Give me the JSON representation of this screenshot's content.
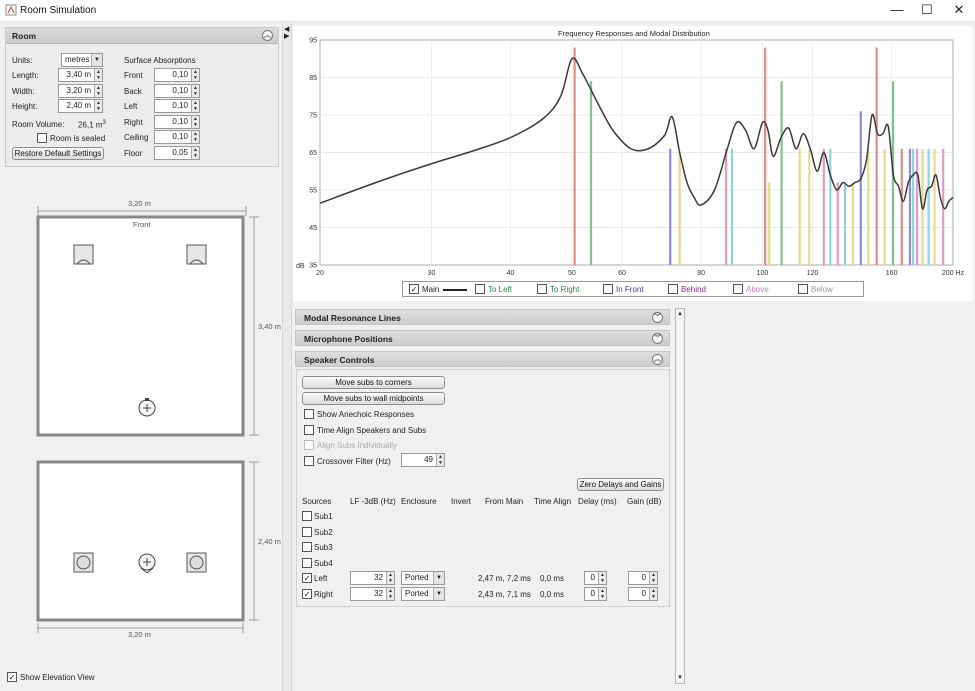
{
  "window": {
    "title": "Room Simulation",
    "minimize": "—",
    "maximize": "☐",
    "close": "✕"
  },
  "room_panel": {
    "title": "Room",
    "units_label": "Units:",
    "units_value": "metres",
    "length_label": "Length:",
    "length_value": "3,40 m",
    "width_label": "Width:",
    "width_value": "3,20 m",
    "height_label": "Height:",
    "height_value": "2,40 m",
    "volume_label": "Room Volume:",
    "volume_value": "26,1 m",
    "volume_unit_sup": "3",
    "sealed_label": "Room is sealed",
    "sealed_checked": false,
    "restore_button": "Restore Default Settings",
    "absorptions_title": "Surface Absorptions",
    "absorptions": [
      {
        "label": "Front",
        "value": "0,10"
      },
      {
        "label": "Back",
        "value": "0,10"
      },
      {
        "label": "Left",
        "value": "0,10"
      },
      {
        "label": "Right",
        "value": "0,10"
      },
      {
        "label": "Ceiling",
        "value": "0,10"
      },
      {
        "label": "Floor",
        "value": "0,05"
      }
    ]
  },
  "plan_view": {
    "top_dim": "3,20 m",
    "side_dim": "3,40 m",
    "front_label": "Front"
  },
  "elevation_view": {
    "side_dim": "2,40 m",
    "bottom_dim": "3,20 m"
  },
  "show_elevation": {
    "label": "Show Elevation View",
    "checked": true
  },
  "chart_data": {
    "type": "line",
    "title": "Frequency Responses and Modal Distribution",
    "ylabel": "dB",
    "xscale": "log",
    "xlim": [
      20,
      200
    ],
    "ylim": [
      35,
      95
    ],
    "x_ticks": [
      "20",
      "30",
      "40",
      "50",
      "60",
      "80",
      "100",
      "120",
      "160",
      "200 Hz"
    ],
    "y_ticks": [
      "35",
      "45",
      "55",
      "65",
      "75",
      "85",
      "95"
    ],
    "series": [
      {
        "name": "Main",
        "color": "#3a3a3a",
        "x": [
          20,
          25,
          30,
          35,
          40,
          45,
          48,
          50,
          52,
          55,
          58,
          62,
          66,
          70,
          72,
          74,
          76,
          78,
          80,
          84,
          88,
          91,
          94,
          97,
          100,
          102,
          104,
          107,
          110,
          113,
          116,
          119,
          122,
          125,
          128,
          131,
          134,
          137,
          140,
          143,
          146,
          149,
          152,
          155,
          158,
          161,
          164,
          167,
          170,
          173,
          176,
          179,
          182,
          185,
          188,
          191,
          194,
          197,
          200
        ],
        "y": [
          51.5,
          57.5,
          62,
          65.5,
          69,
          74,
          80,
          90,
          86,
          78,
          71,
          66,
          66,
          69.5,
          74.5,
          65,
          57,
          53,
          51,
          55,
          66,
          73,
          71,
          66,
          73,
          71,
          64,
          69,
          71.5,
          66,
          70,
          66,
          60,
          65,
          59,
          55,
          57,
          56,
          57,
          58,
          63,
          75,
          70,
          70,
          72,
          59,
          56,
          52,
          57,
          59,
          59,
          50,
          55,
          56,
          59,
          53,
          50,
          52,
          53
        ]
      }
    ],
    "mode_lines": [
      {
        "freq": 50.5,
        "level": 93,
        "color": "#e08b8b",
        "group": "To Left"
      },
      {
        "freq": 53.6,
        "level": 84,
        "color": "#7fc28e",
        "group": "To Left"
      },
      {
        "freq": 71.5,
        "level": 66,
        "color": "#8c8ae0",
        "group": "In Front"
      },
      {
        "freq": 74.0,
        "level": 65,
        "color": "#e8d98a",
        "group": "Behind"
      },
      {
        "freq": 87.6,
        "level": 66,
        "color": "#e09ac8",
        "group": "Above"
      },
      {
        "freq": 89.5,
        "level": 66,
        "color": "#8fd3d8",
        "group": "Below"
      },
      {
        "freq": 101.0,
        "level": 93,
        "color": "#e08b8b",
        "group": "To Left"
      },
      {
        "freq": 102.5,
        "level": 57,
        "color": "#e8d98a",
        "group": "Behind"
      },
      {
        "freq": 107.2,
        "level": 84,
        "color": "#7fc28e",
        "group": "To Left"
      },
      {
        "freq": 114.5,
        "level": 66,
        "color": "#e8d98a",
        "group": "Behind"
      },
      {
        "freq": 118.6,
        "level": 66,
        "color": "#e8d98a",
        "group": "Behind"
      },
      {
        "freq": 125.0,
        "level": 66,
        "color": "#e09ac8",
        "group": "Above"
      },
      {
        "freq": 128.0,
        "level": 66,
        "color": "#8fd3d8",
        "group": "Below"
      },
      {
        "freq": 131.5,
        "level": 57,
        "color": "#e09ac8",
        "group": "Above"
      },
      {
        "freq": 135.0,
        "level": 57,
        "color": "#8fd3d8",
        "group": "Below"
      },
      {
        "freq": 139.0,
        "level": 57,
        "color": "#e8d98a",
        "group": "Behind"
      },
      {
        "freq": 143.0,
        "level": 76,
        "color": "#8c8ae0",
        "group": "In Front"
      },
      {
        "freq": 147.0,
        "level": 66,
        "color": "#e8d98a",
        "group": "Behind"
      },
      {
        "freq": 151.5,
        "level": 93,
        "color": "#e08b8b",
        "group": "To Left"
      },
      {
        "freq": 156.0,
        "level": 66,
        "color": "#e8d98a",
        "group": "Behind"
      },
      {
        "freq": 160.8,
        "level": 84,
        "color": "#7fc28e",
        "group": "To Left"
      },
      {
        "freq": 166.0,
        "level": 66,
        "color": "#e08b8b",
        "group": "To Left"
      },
      {
        "freq": 171.0,
        "level": 66,
        "color": "#8c8ae0",
        "group": "In Front"
      },
      {
        "freq": 173.0,
        "level": 66,
        "color": "#8fd3d8",
        "group": "Below"
      },
      {
        "freq": 175.5,
        "level": 66,
        "color": "#e09ac8",
        "group": "Above"
      },
      {
        "freq": 179.0,
        "level": 66,
        "color": "#e8d98a",
        "group": "Behind"
      },
      {
        "freq": 183.0,
        "level": 66,
        "color": "#8fd3d8",
        "group": "Below"
      },
      {
        "freq": 187.0,
        "level": 66,
        "color": "#e8d98a",
        "group": "Behind"
      },
      {
        "freq": 193.0,
        "level": 66,
        "color": "#e09ac8",
        "group": "Above"
      }
    ],
    "legend": [
      {
        "label": "Main",
        "checked": true,
        "color": "#222222",
        "line": true
      },
      {
        "label": "To Left",
        "checked": false,
        "color": "#2a8a3e"
      },
      {
        "label": "To Right",
        "checked": false,
        "color": "#2a8a3e"
      },
      {
        "label": "In Front",
        "checked": false,
        "color": "#3b3bb5"
      },
      {
        "label": "Behind",
        "checked": false,
        "color": "#8a2a8a"
      },
      {
        "label": "Above",
        "checked": false,
        "color": "#d07ad0"
      },
      {
        "label": "Below",
        "checked": false,
        "color": "#9a9a9a"
      }
    ]
  },
  "sections": {
    "modal_resonance": "Modal Resonance Lines",
    "mic_positions": "Microphone Positions",
    "speaker_controls": "Speaker Controls"
  },
  "speaker_controls": {
    "move_corners": "Move subs to corners",
    "move_midpoints": "Move subs to wall midpoints",
    "show_anechoic": "Show Anechoic Responses",
    "time_align": "Time Align Speakers and Subs",
    "align_subs": "Align Subs Individually",
    "crossover": "Crossover Filter (Hz)",
    "crossover_value": "49",
    "zero_button": "Zero Delays and Gains",
    "headers": [
      "Sources",
      "LF -3dB (Hz)",
      "Enclosure",
      "Invert",
      "From Main",
      "Time Align",
      "Delay (ms)",
      "Gain (dB)"
    ],
    "subs": [
      "Sub1",
      "Sub2",
      "Sub3",
      "Sub4"
    ],
    "mains": [
      {
        "name": "Left",
        "checked": true,
        "lf": "32",
        "enclosure": "Ported",
        "from_main": "2,47 m, 7,2 ms",
        "time_align": "0,0 ms",
        "delay": "0",
        "gain": "0"
      },
      {
        "name": "Right",
        "checked": true,
        "lf": "32",
        "enclosure": "Ported",
        "from_main": "2,43 m, 7,1 ms",
        "time_align": "0,0 ms",
        "delay": "0",
        "gain": "0"
      }
    ]
  }
}
